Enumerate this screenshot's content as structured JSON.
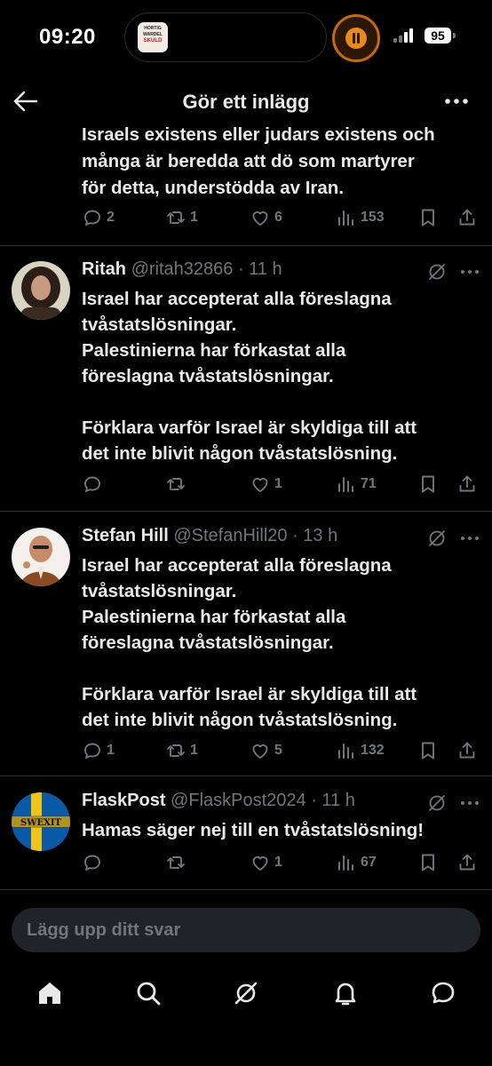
{
  "status_bar": {
    "time": "09:20",
    "battery": "95",
    "island_thumb_line1": "HORTIG",
    "island_thumb_line2": "WARDEL",
    "island_thumb_line3": "SKULD",
    "accent_color": "#e88a1a"
  },
  "header": {
    "title": "Gör ett inlägg"
  },
  "continued_post": {
    "text": "Israels existens eller judars existens och\nmånga är beredda att dö som martyrer\nför detta, understödda av Iran.",
    "actions": {
      "replies": "2",
      "reposts": "1",
      "likes": "6",
      "views": "153"
    }
  },
  "replies": [
    {
      "name": "Ritah",
      "handle": "@ritah32866",
      "time": "· 11 h",
      "text": "Israel har accepterat alla föreslagna\ntvåstatslösningar.\nPalestinierna har förkastat alla\nföreslagna tvåstatslösningar.\n\nFörklara varför Israel är skyldiga till att\ndet inte blivit någon tvåstatslösning.",
      "actions": {
        "replies": "",
        "reposts": "",
        "likes": "1",
        "views": "71"
      }
    },
    {
      "name": "Stefan Hill",
      "handle": "@StefanHill20",
      "time": "· 13 h",
      "text": "Israel har accepterat alla föreslagna\ntvåstatslösningar.\nPalestinierna har förkastat alla\nföreslagna tvåstatslösningar.\n\nFörklara varför Israel är skyldiga till att\ndet inte blivit någon tvåstatslösning.",
      "actions": {
        "replies": "1",
        "reposts": "1",
        "likes": "5",
        "views": "132"
      }
    },
    {
      "name": "FlaskPost",
      "handle": "@FlaskPost2024",
      "time": "· 11 h",
      "avatar_text": "SWEXIT",
      "text": "Hamas säger nej till en tvåstatslösning!",
      "actions": {
        "replies": "",
        "reposts": "",
        "likes": "1",
        "views": "67"
      }
    }
  ],
  "reply_input": {
    "placeholder": "Lägg upp ditt svar"
  },
  "bottom_nav": [
    "home-icon",
    "search-icon",
    "grok-icon",
    "notifications-icon",
    "messages-icon"
  ]
}
